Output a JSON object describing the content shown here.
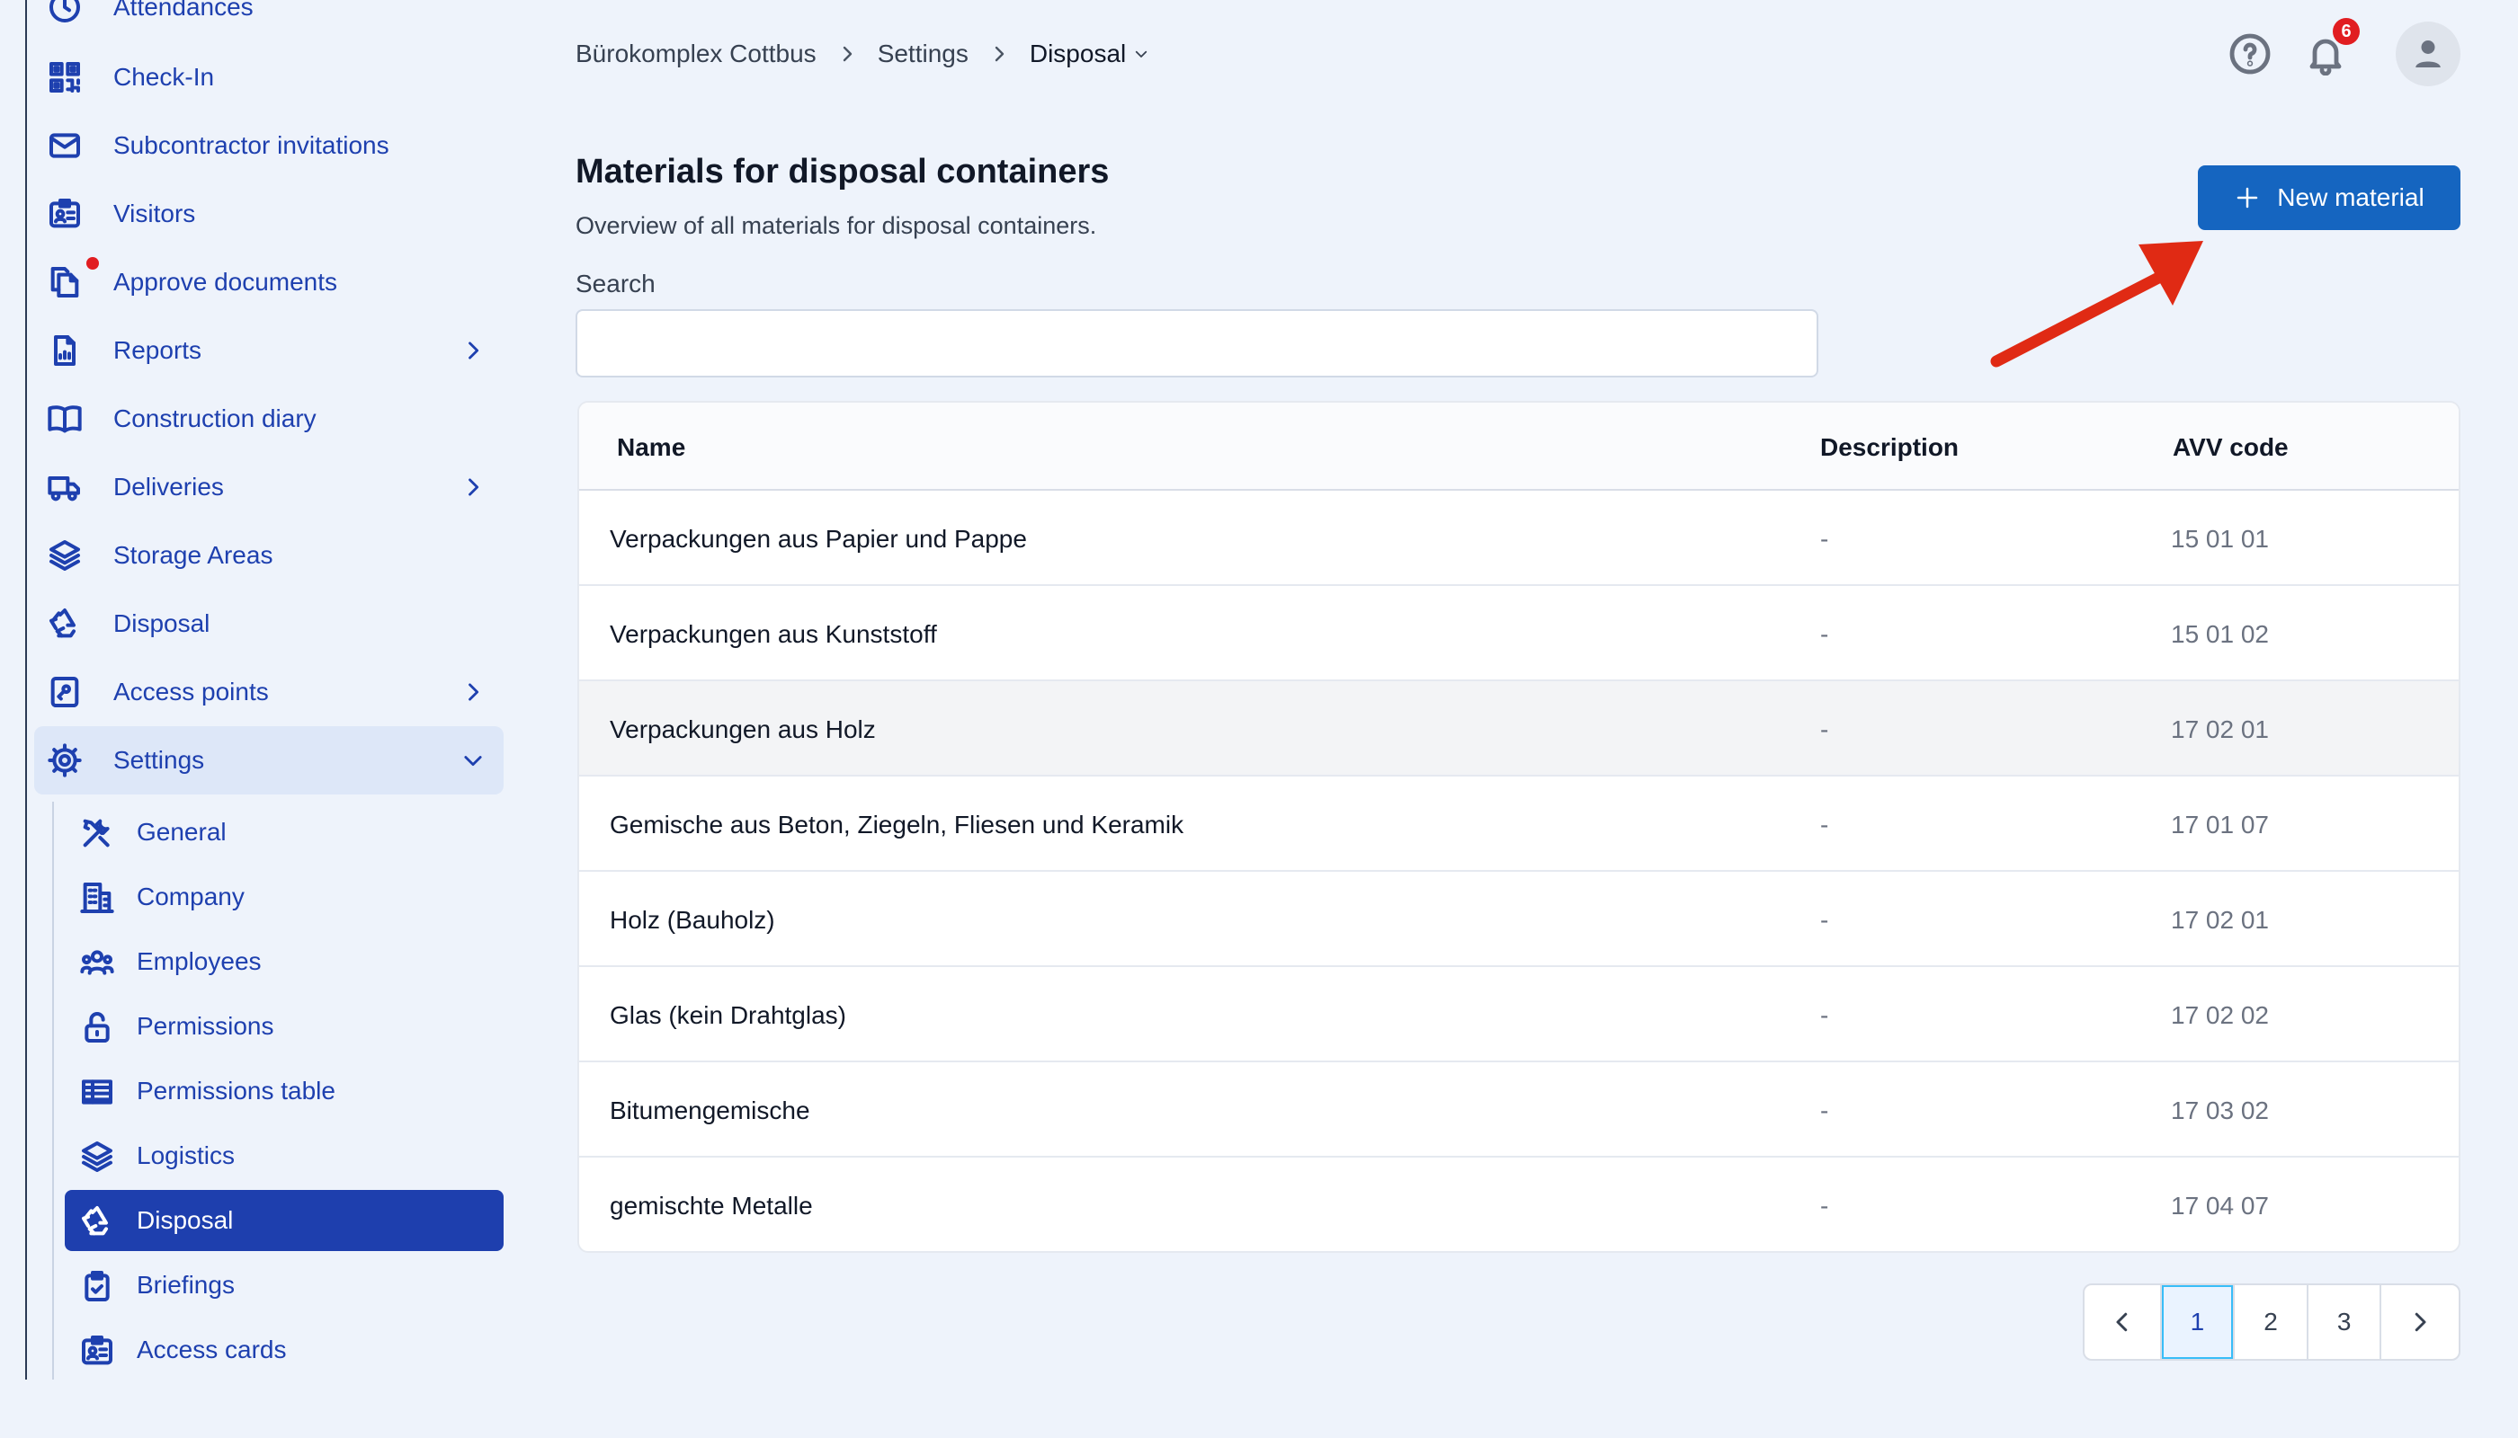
{
  "sidebar": {
    "items": [
      {
        "label": "Attendances",
        "icon": "clock-icon"
      },
      {
        "label": "Check-In",
        "icon": "qr-code-icon"
      },
      {
        "label": "Subcontractor invitations",
        "icon": "envelope-icon"
      },
      {
        "label": "Visitors",
        "icon": "id-badge-icon"
      },
      {
        "label": "Approve documents",
        "icon": "documents-icon"
      },
      {
        "label": "Reports",
        "icon": "report-icon"
      },
      {
        "label": "Construction diary",
        "icon": "book-icon"
      },
      {
        "label": "Deliveries",
        "icon": "truck-icon"
      },
      {
        "label": "Storage Areas",
        "icon": "layers-icon"
      },
      {
        "label": "Disposal",
        "icon": "recycle-icon"
      },
      {
        "label": "Access points",
        "icon": "access-point-icon"
      },
      {
        "label": "Settings",
        "icon": "gear-icon"
      }
    ],
    "settings_sub": [
      {
        "label": "General",
        "icon": "tools-icon"
      },
      {
        "label": "Company",
        "icon": "building-icon"
      },
      {
        "label": "Employees",
        "icon": "users-icon"
      },
      {
        "label": "Permissions",
        "icon": "lock-open-icon"
      },
      {
        "label": "Permissions table",
        "icon": "table-icon"
      },
      {
        "label": "Logistics",
        "icon": "layers-icon"
      },
      {
        "label": "Disposal",
        "icon": "recycle-icon"
      },
      {
        "label": "Briefings",
        "icon": "clipboard-check-icon"
      },
      {
        "label": "Access cards",
        "icon": "id-card-icon"
      }
    ],
    "active_sub": "Disposal"
  },
  "header": {
    "breadcrumb": [
      "Bürokomplex Cottbus",
      "Settings",
      "Disposal"
    ],
    "notification_count": "6"
  },
  "main": {
    "title": "Materials for disposal containers",
    "subtitle": "Overview of all materials for disposal containers.",
    "new_button_label": "New material",
    "search_label": "Search",
    "search_value": ""
  },
  "table": {
    "headers": {
      "name": "Name",
      "description": "Description",
      "avv": "AVV code"
    },
    "rows": [
      {
        "name": "Verpackungen aus Papier und Pappe",
        "description": "-",
        "avv": "15 01 01"
      },
      {
        "name": "Verpackungen aus Kunststoff",
        "description": "-",
        "avv": "15 01 02"
      },
      {
        "name": "Verpackungen aus Holz",
        "description": "-",
        "avv": "17 02 01"
      },
      {
        "name": "Gemische aus Beton, Ziegeln, Fliesen und Keramik",
        "description": "-",
        "avv": "17 01 07"
      },
      {
        "name": "Holz (Bauholz)",
        "description": "-",
        "avv": "17 02 01"
      },
      {
        "name": "Glas (kein Drahtglas)",
        "description": "-",
        "avv": "17 02 02"
      },
      {
        "name": "Bitumengemische",
        "description": "-",
        "avv": "17 03 02"
      },
      {
        "name": "gemischte Metalle",
        "description": "-",
        "avv": "17 04 07"
      }
    ]
  },
  "pagination": {
    "pages": [
      "1",
      "2",
      "3"
    ],
    "current": "1"
  },
  "colors": {
    "accent": "#1565c0",
    "active_nav": "#1e3fae",
    "badge": "#e11d21",
    "annotation_arrow": "#e02a14"
  }
}
